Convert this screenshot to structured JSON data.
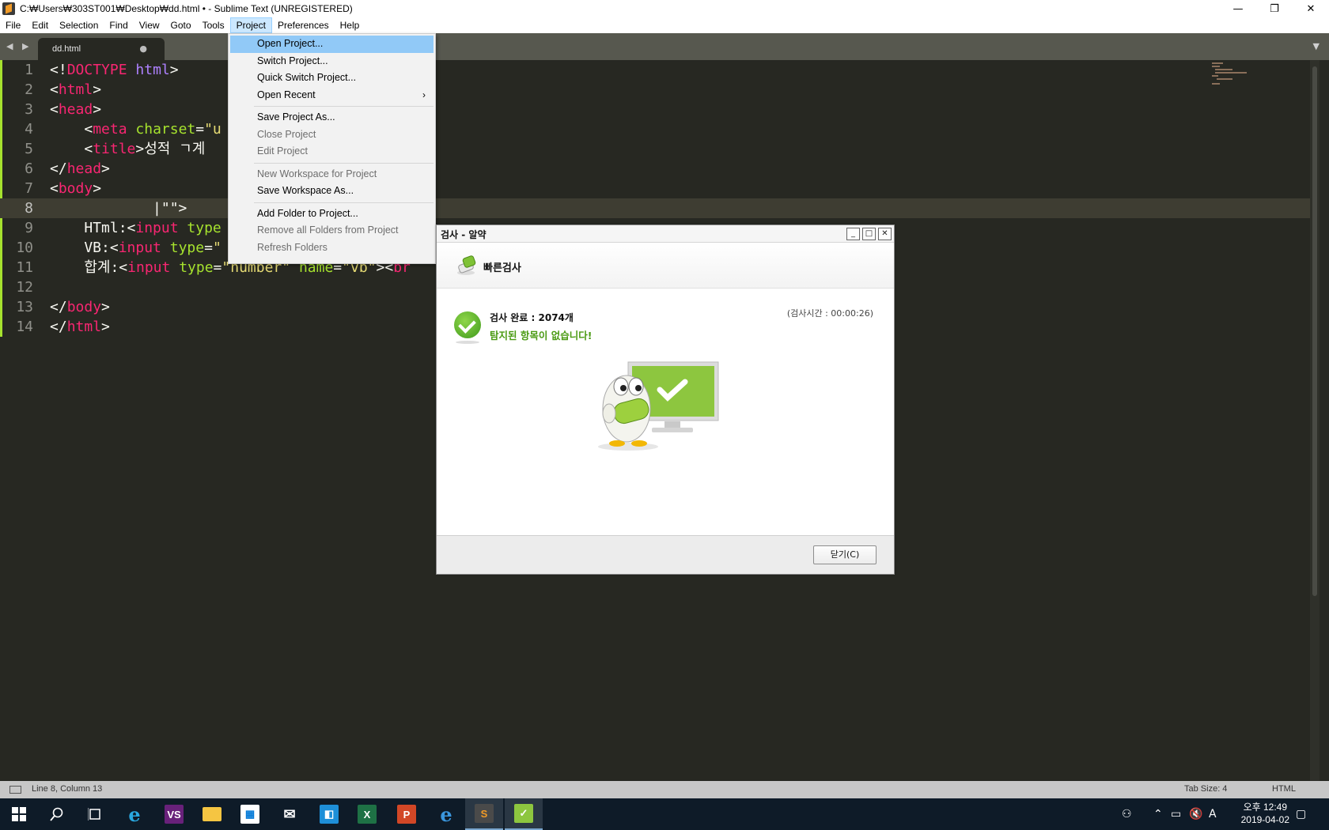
{
  "window": {
    "title": "C:₩Users₩303ST001₩Desktop₩dd.html • - Sublime Text (UNREGISTERED)",
    "minimize": "—",
    "maximize": "❐",
    "close": "✕"
  },
  "menubar": {
    "items": [
      "File",
      "Edit",
      "Selection",
      "Find",
      "View",
      "Goto",
      "Tools",
      "Project",
      "Preferences",
      "Help"
    ],
    "active": "Project"
  },
  "tabs": {
    "nav_arrows": "◀ ▶",
    "active_tab": "dd.html",
    "dirty_marker": "●",
    "overflow_arrow": "▼"
  },
  "project_menu": {
    "items": [
      {
        "label": "Open Project...",
        "state": "highlight"
      },
      {
        "label": "Switch Project...",
        "state": "normal"
      },
      {
        "label": "Quick Switch Project...",
        "state": "normal"
      },
      {
        "label": "Open Recent",
        "state": "normal",
        "submenu": "›"
      },
      {
        "label": "Save Project As...",
        "state": "normal"
      },
      {
        "label": "Close Project",
        "state": "disabled"
      },
      {
        "label": "Edit Project",
        "state": "disabled"
      },
      {
        "label": "New Workspace for Project",
        "state": "disabled"
      },
      {
        "label": "Save Workspace As...",
        "state": "normal"
      },
      {
        "label": "Add Folder to Project...",
        "state": "normal"
      },
      {
        "label": "Remove all Folders from Project",
        "state": "disabled"
      },
      {
        "label": "Refresh Folders",
        "state": "disabled"
      }
    ]
  },
  "editor": {
    "line_numbers": [
      "1",
      "2",
      "3",
      "4",
      "5",
      "6",
      "7",
      "8",
      "9",
      "10",
      "11",
      "12",
      "13",
      "14"
    ],
    "current_line": 8,
    "lines": [
      [
        [
          "pn",
          "<!"
        ],
        [
          "tg",
          "DOCTYPE"
        ],
        [
          "pn",
          " "
        ],
        [
          "kw",
          "html"
        ],
        [
          "pn",
          ">"
        ]
      ],
      [
        [
          "pn",
          "<"
        ],
        [
          "tg",
          "html"
        ],
        [
          "pn",
          ">"
        ]
      ],
      [
        [
          "pn",
          "<"
        ],
        [
          "tg",
          "head"
        ],
        [
          "pn",
          ">"
        ]
      ],
      [
        [
          "pn",
          "    <"
        ],
        [
          "tg",
          "meta"
        ],
        [
          "pn",
          " "
        ],
        [
          "at",
          "charset"
        ],
        [
          "pn",
          "="
        ],
        [
          "st",
          "\"u"
        ]
      ],
      [
        [
          "pn",
          "    <"
        ],
        [
          "tg",
          "title"
        ],
        [
          "pn",
          ">성적 ㄱ계"
        ]
      ],
      [
        [
          "pn",
          "</"
        ],
        [
          "tg",
          "head"
        ],
        [
          "pn",
          ">"
        ]
      ],
      [
        [
          "pn",
          "<"
        ],
        [
          "tg",
          "body"
        ],
        [
          "pn",
          ">"
        ]
      ],
      [
        [
          "pn",
          "            |\"\">"
        ]
      ],
      [
        [
          "pn",
          "    HTml:<"
        ],
        [
          "tg",
          "input"
        ],
        [
          "pn",
          " "
        ],
        [
          "at",
          "type"
        ]
      ],
      [
        [
          "pn",
          "    VB:<"
        ],
        [
          "tg",
          "input"
        ],
        [
          "pn",
          " "
        ],
        [
          "at",
          "type"
        ],
        [
          "pn",
          "="
        ],
        [
          "st",
          "\""
        ]
      ],
      [
        [
          "pn",
          "    합계:<"
        ],
        [
          "tg",
          "input"
        ],
        [
          "pn",
          " "
        ],
        [
          "at",
          "type"
        ],
        [
          "pn",
          "="
        ],
        [
          "st",
          "\"number\""
        ],
        [
          "pn",
          " "
        ],
        [
          "at",
          "name"
        ],
        [
          "pn",
          "="
        ],
        [
          "st",
          "\"vb\""
        ],
        [
          "pn",
          "><"
        ],
        [
          "tg",
          "br"
        ]
      ],
      [],
      [
        [
          "pn",
          "</"
        ],
        [
          "tg",
          "body"
        ],
        [
          "pn",
          ">"
        ]
      ],
      [
        [
          "pn",
          "</"
        ],
        [
          "tg",
          "html"
        ],
        [
          "pn",
          ">"
        ]
      ]
    ]
  },
  "scan_dialog": {
    "title": "검사 - 알약",
    "header_title": "빠른검사",
    "result": "검사 완료 : 2074개",
    "message": "탐지된 항목이 없습니다!",
    "elapsed": "(검사시간 : 00:00:26)",
    "close_button": "닫기(C)",
    "btn_min": "_",
    "btn_max": "□",
    "btn_close": "✕"
  },
  "statusbar": {
    "position": "Line 8, Column 13",
    "tab_size": "Tab Size: 4",
    "syntax": "HTML"
  },
  "taskbar": {
    "apps": [
      "start-icon",
      "search-icon",
      "task-view-icon",
      "internet-explorer-icon",
      "visual-studio-icon",
      "file-explorer-icon",
      "store-icon",
      "mail-icon",
      "app-icon",
      "excel-icon",
      "powerpoint-icon",
      "edge-icon",
      "sublime-text-icon",
      "alyac-icon"
    ],
    "time": "오후 12:49",
    "date": "2019-04-02",
    "ime": "A"
  },
  "colors": {
    "editor_bg": "#272822",
    "tag": "#f92672",
    "attr": "#a6e22e",
    "string": "#e6db74",
    "keyword": "#ae81ff",
    "menu_highlight": "#91c9f7",
    "success_green": "#4a9a12"
  }
}
